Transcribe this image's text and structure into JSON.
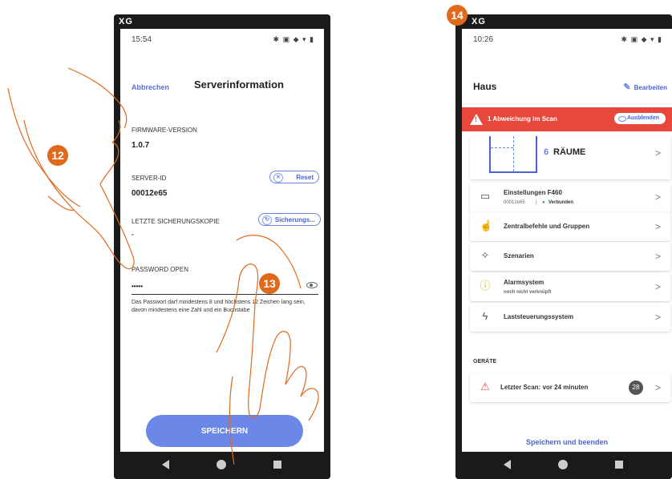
{
  "left_phone": {
    "mini_icons": "XG",
    "status": {
      "time": "15:54",
      "icons": "✱ ▣ ◆ ▾ ▮"
    },
    "header": {
      "cancel": "Abbrechen",
      "title": "Serverinformation"
    },
    "firmware": {
      "label": "FIRMWARE-VERSION",
      "value": "1.0.7"
    },
    "server_id": {
      "label": "SERVER-ID",
      "value": "00012e65",
      "reset": "Reset"
    },
    "backup": {
      "label": "LETZTE SICHERUNGSKOPIE",
      "value": "-",
      "button": "Sicherungs..."
    },
    "password": {
      "label": "PASSWORD OPEN",
      "value": "•••••",
      "hint": "Das Passwort darf mindestens 8 und höchstens 12 Zeichen lang sein, davon mindestens eine Zahl und ein Buchstabe"
    },
    "save_button": "SPEICHERN"
  },
  "right_phone": {
    "mini_icons": "XG",
    "status": {
      "time": "10:26",
      "icons": "✱ ▣ ◆ ▾ ▮"
    },
    "title": "Haus",
    "edit": "Bearbeiten",
    "alert": {
      "text": "1 Abweichung im Scan",
      "hide": "Ausblenden"
    },
    "rooms": {
      "count": "6",
      "label": "RÄUME"
    },
    "menu": [
      {
        "title": "Einstellungen F460",
        "sub_id": "00012e65",
        "sub_status": "Verbunden"
      },
      {
        "title": "Zentralbefehle und Gruppen"
      },
      {
        "title": "Szenarien"
      },
      {
        "title": "Alarmsystem",
        "sub": "noch nicht verknüpft"
      },
      {
        "title": "Laststeuerungssystem"
      }
    ],
    "devices_header": "GERÄTE",
    "last_scan": {
      "text": "Letzter Scan: vor 24 minuten",
      "count": "28"
    },
    "finish": "Speichern und beenden"
  },
  "badges": {
    "b12": "12",
    "b13": "13",
    "b14": "14"
  },
  "colors": {
    "accent": "#6b88e8",
    "badge": "#e06a1c",
    "alert": "#e8473c"
  }
}
